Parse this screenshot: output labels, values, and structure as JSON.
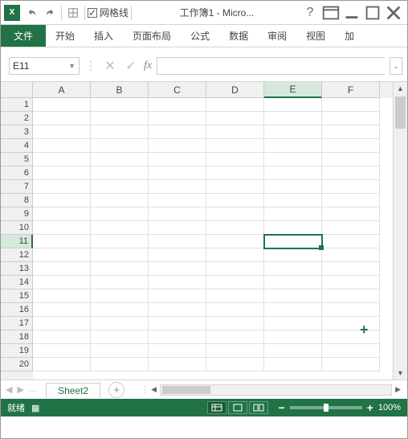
{
  "titlebar": {
    "gridlines_label": "网格线",
    "gridlines_checked": true,
    "title": "工作簿1 - Micro..."
  },
  "ribbon": {
    "file": "文件",
    "tabs": [
      "开始",
      "插入",
      "页面布局",
      "公式",
      "数据",
      "审阅",
      "视图",
      "加"
    ]
  },
  "formula": {
    "name_box": "E11",
    "fx_label": "fx",
    "value": ""
  },
  "grid": {
    "columns": [
      "A",
      "B",
      "C",
      "D",
      "E",
      "F"
    ],
    "rows": [
      1,
      2,
      3,
      4,
      5,
      6,
      7,
      8,
      9,
      10,
      11,
      12,
      13,
      14,
      15,
      16,
      17,
      18,
      19,
      20
    ],
    "active_col": "E",
    "active_row": 11
  },
  "sheets": {
    "active": "Sheet2",
    "ellipsis": "..."
  },
  "status": {
    "ready": "就绪",
    "zoom": "100%"
  }
}
